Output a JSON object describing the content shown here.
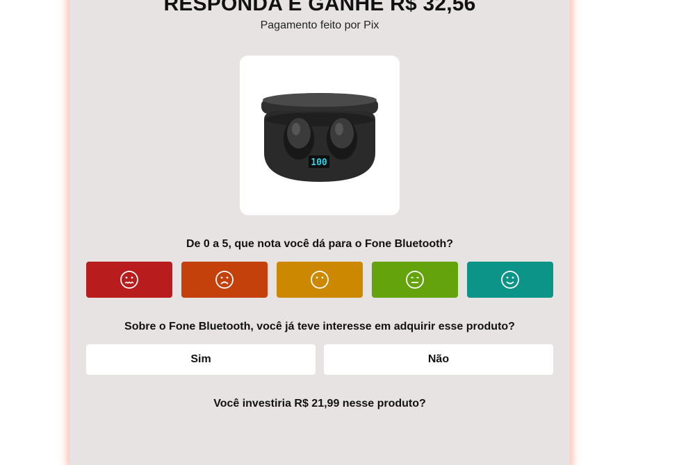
{
  "header": {
    "title": "RESPONDA E GANHE R$ 32,56",
    "subtitle": "Pagamento feito por Pix"
  },
  "product": {
    "image_icon": "earbuds-product-image",
    "case_display": "100"
  },
  "question1": {
    "text": "De 0 a 5, que nota você dá para o Fone Bluetooth?",
    "options": [
      {
        "icon": "very-sad-face-icon",
        "color": "#b81c1c"
      },
      {
        "icon": "sad-face-icon",
        "color": "#c4410c"
      },
      {
        "icon": "neutral-face-icon",
        "color": "#cc8800"
      },
      {
        "icon": "meh-face-icon",
        "color": "#65a30d"
      },
      {
        "icon": "happy-face-icon",
        "color": "#0d9488"
      }
    ]
  },
  "question2": {
    "text": "Sobre o Fone Bluetooth, você já teve interesse em adquirir esse produto?",
    "yes_label": "Sim",
    "no_label": "Não"
  },
  "question3": {
    "text": "Você investiria R$ 21,99 nesse produto?"
  }
}
